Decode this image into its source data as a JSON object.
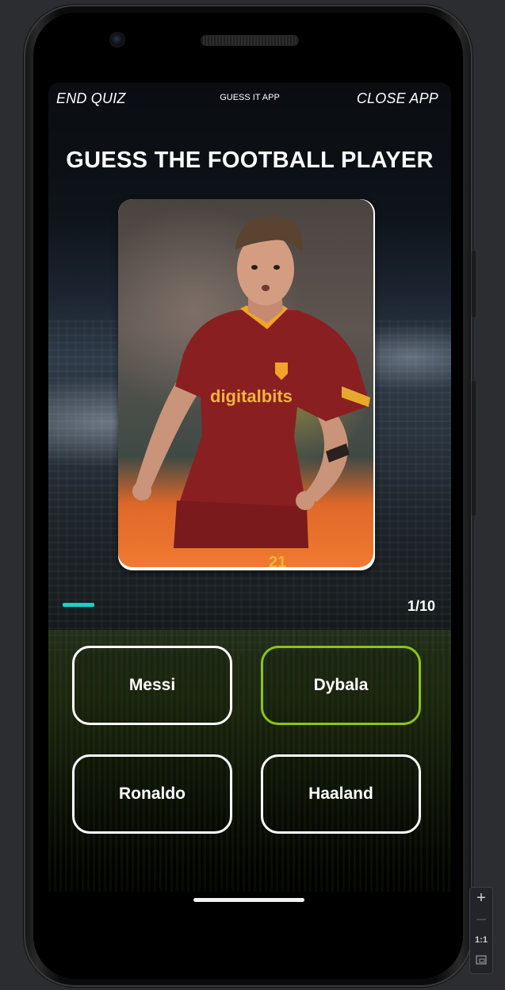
{
  "top_bar": {
    "end_quiz": "END QUIZ",
    "app_name": "GUESS IT APP",
    "close_app": "CLOSE APP"
  },
  "quiz": {
    "title": "GUESS THE FOOTBALL PLAYER",
    "progress": {
      "current": 1,
      "total": 10,
      "label": "1/10",
      "fill_fraction": 0.1
    },
    "answers": [
      {
        "label": "Messi",
        "selected": false
      },
      {
        "label": "Dybala",
        "selected": true
      },
      {
        "label": "Ronaldo",
        "selected": false
      },
      {
        "label": "Haaland",
        "selected": false
      }
    ]
  },
  "player_photo": {
    "sponsor_text": "digitalbits",
    "shirt_number": "21"
  },
  "colors": {
    "accent_progress": "#19d3c5",
    "selected_border": "#8bc418",
    "jersey": "#8a1f22"
  },
  "emulator_toolbar": {
    "zoom_in": "+",
    "zoom_out": "—",
    "actual_size": "1:1",
    "fit_icon": "fit-screen-icon"
  }
}
